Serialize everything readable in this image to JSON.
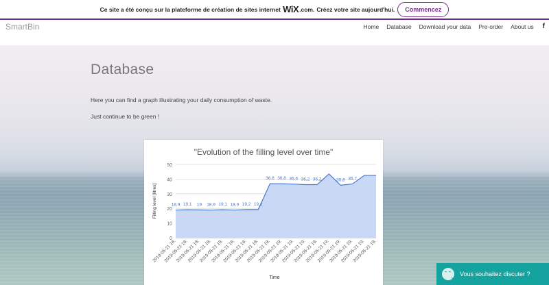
{
  "banner": {
    "text": "Ce site a été conçu sur la plateforme de création de sites internet",
    "wix_logo": "WiX",
    "wix_suffix": ".com.",
    "text2": "Créez votre site aujourd'hui.",
    "cta_label": "Commencez"
  },
  "header": {
    "brand": "SmartBin",
    "nav": [
      "Home",
      "Database",
      "Download your data",
      "Pre-order",
      "About us"
    ],
    "facebook_icon": "facebook-icon",
    "facebook_glyph": "f"
  },
  "main": {
    "title": "Database",
    "paragraph1": "Here you can find a graph illustrating your daily consumption of waste.",
    "paragraph2": "Just continue to be green !"
  },
  "chat": {
    "label": "Vous souhaitez discuter ?",
    "icon": "smiley-icon",
    "color": "#15a3a0"
  },
  "chart_data": {
    "type": "area",
    "title": "\"Evolution of the filling level over time\"",
    "xlabel": "Time",
    "ylabel": "Filling level [litres]",
    "ylim": [
      0,
      50
    ],
    "yticks": [
      0,
      10,
      20,
      30,
      40,
      50
    ],
    "grid": true,
    "x": [
      "2019-05-21 18:",
      "2019-05-21 18:",
      "2019-05-21 18:",
      "2019-05-21 18:",
      "2019-05-21 18:",
      "2019-05-21 18:",
      "2019-05-21 18:",
      "2019-05-21 18:",
      "2019-05-21 18:",
      "2019-05-21 19:",
      "2019-05-21 19:",
      "2019-05-21 19:",
      "2019-05-21 19:",
      "2019-05-21 19:",
      "2019-05-21 19:",
      "2019-05-21 19:",
      "2019-05-21 19:",
      "2019-05-21 19:"
    ],
    "values": [
      18.9,
      19.1,
      19,
      18.9,
      19.1,
      18.9,
      19.2,
      19.2,
      36.8,
      36.8,
      36.6,
      36.2,
      36.2,
      43.5,
      35.8,
      36.7,
      42.5,
      42.5
    ],
    "labels": [
      "18,9",
      "19,1",
      "19",
      "18,9",
      "19,1",
      "18,9",
      "19,2",
      "19,2",
      "36,8",
      "36,8",
      "36,6",
      "36,2",
      "36,2",
      "",
      "35,8",
      "36,7",
      "",
      ""
    ],
    "line_color": "#4a78c8",
    "fill_color": "#c8d8f5",
    "label_color": "#4a78c8"
  }
}
